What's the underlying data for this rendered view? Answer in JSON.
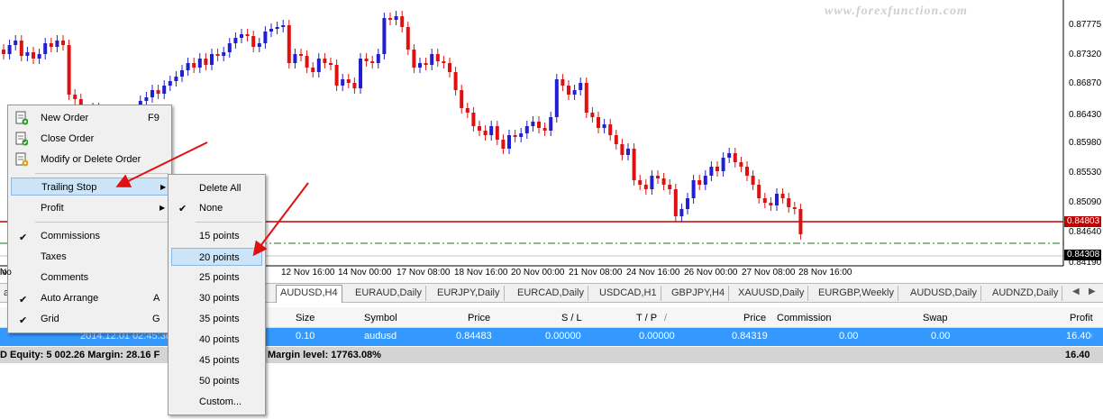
{
  "watermark": "www.forexfunction.com",
  "price_axis": [
    "0.87775",
    "0.87320",
    "0.86870",
    "0.86430",
    "0.85980",
    "0.85530",
    "0.85090",
    "0.84640",
    "0.84190"
  ],
  "price_tags": {
    "line_price": "0.84803",
    "current_price": "0.84308"
  },
  "date_axis": [
    "12 Nov 16:00",
    "14 Nov 00:00",
    "17 Nov 08:00",
    "18 Nov 16:00",
    "20 Nov 00:00",
    "21 Nov 08:00",
    "24 Nov 16:00",
    "26 Nov 00:00",
    "27 Nov 08:00",
    "28 Nov 16:00"
  ],
  "date_axis_partial": "lo",
  "colors": {
    "bull": "#2020d0",
    "bear": "#e01010",
    "hline": "#c00000",
    "trail": "#207020",
    "accent": "#3399ff",
    "arrow": "#e01010"
  },
  "chart_tabs": [
    {
      "label": "AUDUSD,H4",
      "active": true
    },
    {
      "label": "EURAUD,Daily"
    },
    {
      "label": "EURJPY,Daily"
    },
    {
      "label": "EURCAD,Daily"
    },
    {
      "label": "USDCAD,H1"
    },
    {
      "label": "GBPJPY,H4"
    },
    {
      "label": "XAUUSD,Daily"
    },
    {
      "label": "EURGBP,Weekly"
    },
    {
      "label": "AUDUSD,Daily"
    },
    {
      "label": "AUDNZD,Daily"
    }
  ],
  "tab_left_partial": "aily",
  "terminal": {
    "headers": {
      "size": "Size",
      "symbol": "Symbol",
      "price": "Price",
      "sl": "S / L",
      "tp": "T / P",
      "tp_mark": "/",
      "price2": "Price",
      "commission": "Commission",
      "swap": "Swap",
      "profit": "Profit"
    },
    "order": {
      "time": "2014.12.01 02:45:36",
      "size": "0.10",
      "symbol": "audusd",
      "price": "0.84483",
      "sl": "0.00000",
      "tp": "0.00000",
      "price2": "0.84319",
      "commission": "0.00",
      "swap": "0.00",
      "profit": "16.40",
      "close": "×"
    },
    "summary": {
      "left": "D  Equity: 5 002.26  Margin: 28.16  F",
      "margin_level": "Margin level: 17763.08%",
      "profit": "16.40"
    }
  },
  "context_menu": {
    "items": [
      {
        "label": "New Order",
        "shortcut": "F9",
        "icon": "new-order-icon"
      },
      {
        "label": "Close Order",
        "icon": "close-order-icon"
      },
      {
        "label": "Modify or Delete Order",
        "icon": "modify-order-icon"
      },
      {
        "label": "Trailing Stop",
        "submenu": true,
        "highlighted": true
      },
      {
        "label": "Profit",
        "submenu": true
      },
      {
        "label": "Commissions",
        "checked": true
      },
      {
        "label": "Taxes"
      },
      {
        "label": "Comments"
      },
      {
        "label": "Auto Arrange",
        "shortcut": "A",
        "checked": true
      },
      {
        "label": "Grid",
        "shortcut": "G",
        "checked": true
      }
    ],
    "left_edge_fragments": [
      "No",
      "D",
      "D"
    ]
  },
  "submenu": {
    "items": [
      {
        "label": "Delete All"
      },
      {
        "label": "None",
        "checked": true
      },
      {
        "label": "15 points"
      },
      {
        "label": "20 points",
        "highlighted": true
      },
      {
        "label": "25 points"
      },
      {
        "label": "30 points"
      },
      {
        "label": "35 points"
      },
      {
        "label": "40 points"
      },
      {
        "label": "45 points"
      },
      {
        "label": "50 points"
      },
      {
        "label": "Custom..."
      }
    ]
  }
}
